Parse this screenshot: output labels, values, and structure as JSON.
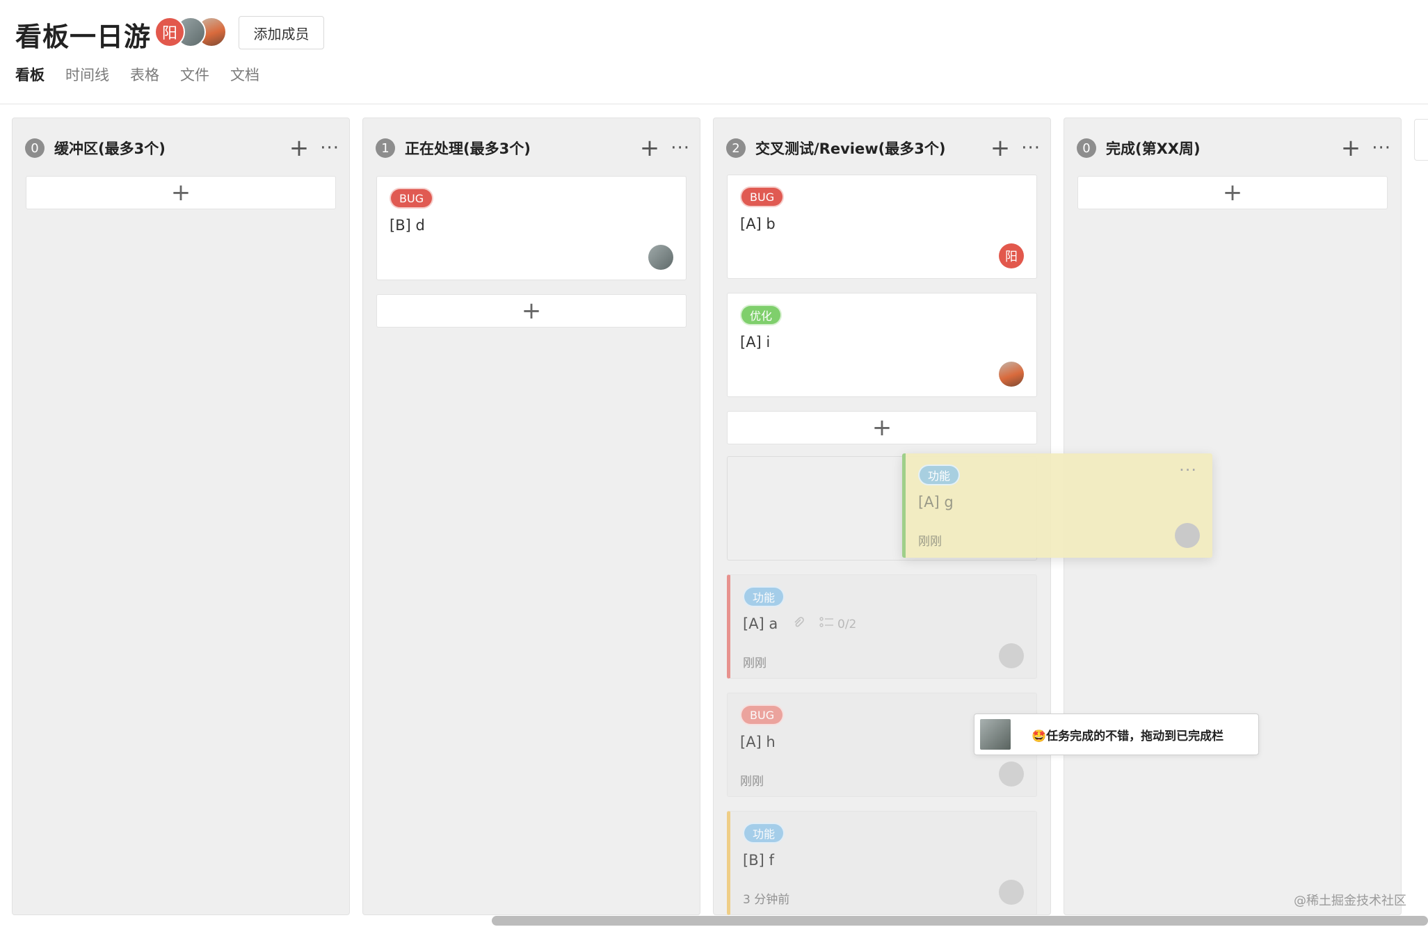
{
  "header": {
    "title": "看板一日游",
    "members": [
      {
        "initial": "阳",
        "color": "#e2584c"
      },
      {
        "initial": "",
        "icon": "avatar-photo-gray"
      },
      {
        "initial": "",
        "icon": "avatar-photo-orange"
      }
    ],
    "add_member_label": "添加成员",
    "tabs": [
      {
        "label": "看板",
        "active": true
      },
      {
        "label": "时间线",
        "active": false
      },
      {
        "label": "表格",
        "active": false
      },
      {
        "label": "文件",
        "active": false
      },
      {
        "label": "文档",
        "active": false
      }
    ]
  },
  "columns": [
    {
      "count": "0",
      "title": "缓冲区(最多3个)",
      "plus": "+",
      "more": "···"
    },
    {
      "count": "1",
      "title": "正在处理(最多3个)",
      "plus": "+",
      "more": "···"
    },
    {
      "count": "2",
      "title": "交叉测试/Review(最多3个)",
      "plus": "+",
      "more": "···"
    },
    {
      "count": "0",
      "title": "完成(第XX周)",
      "plus": "+",
      "more": "···"
    }
  ],
  "add_card_symbol": "+",
  "cards": {
    "b_d": {
      "tag": "BUG",
      "text": "[B] d"
    },
    "a_b": {
      "tag": "BUG",
      "text": "[A] b",
      "avatar": "阳"
    },
    "a_i": {
      "tag": "优化",
      "text": "[A] i"
    },
    "a_a": {
      "tag": "功能",
      "text": "[A] a",
      "subtasks": "0/2",
      "time": "刚刚"
    },
    "a_h": {
      "tag": "BUG",
      "text": "[A] h",
      "time": "刚刚"
    },
    "b_f": {
      "tag": "功能",
      "text": "[B] f",
      "time": "3 分钟前"
    }
  },
  "dragging_card": {
    "tag": "功能",
    "text": "[A] g",
    "time": "刚刚",
    "more": "···"
  },
  "tooltip": {
    "text": "🤩任务完成的不错，拖动到已完成栏"
  },
  "watermark": "@稀土掘金技术社区",
  "colors": {
    "bug": "#e05a52",
    "optimize": "#7fcf6c",
    "feature": "#8fc4e8",
    "accent_red": "#e2584c"
  }
}
